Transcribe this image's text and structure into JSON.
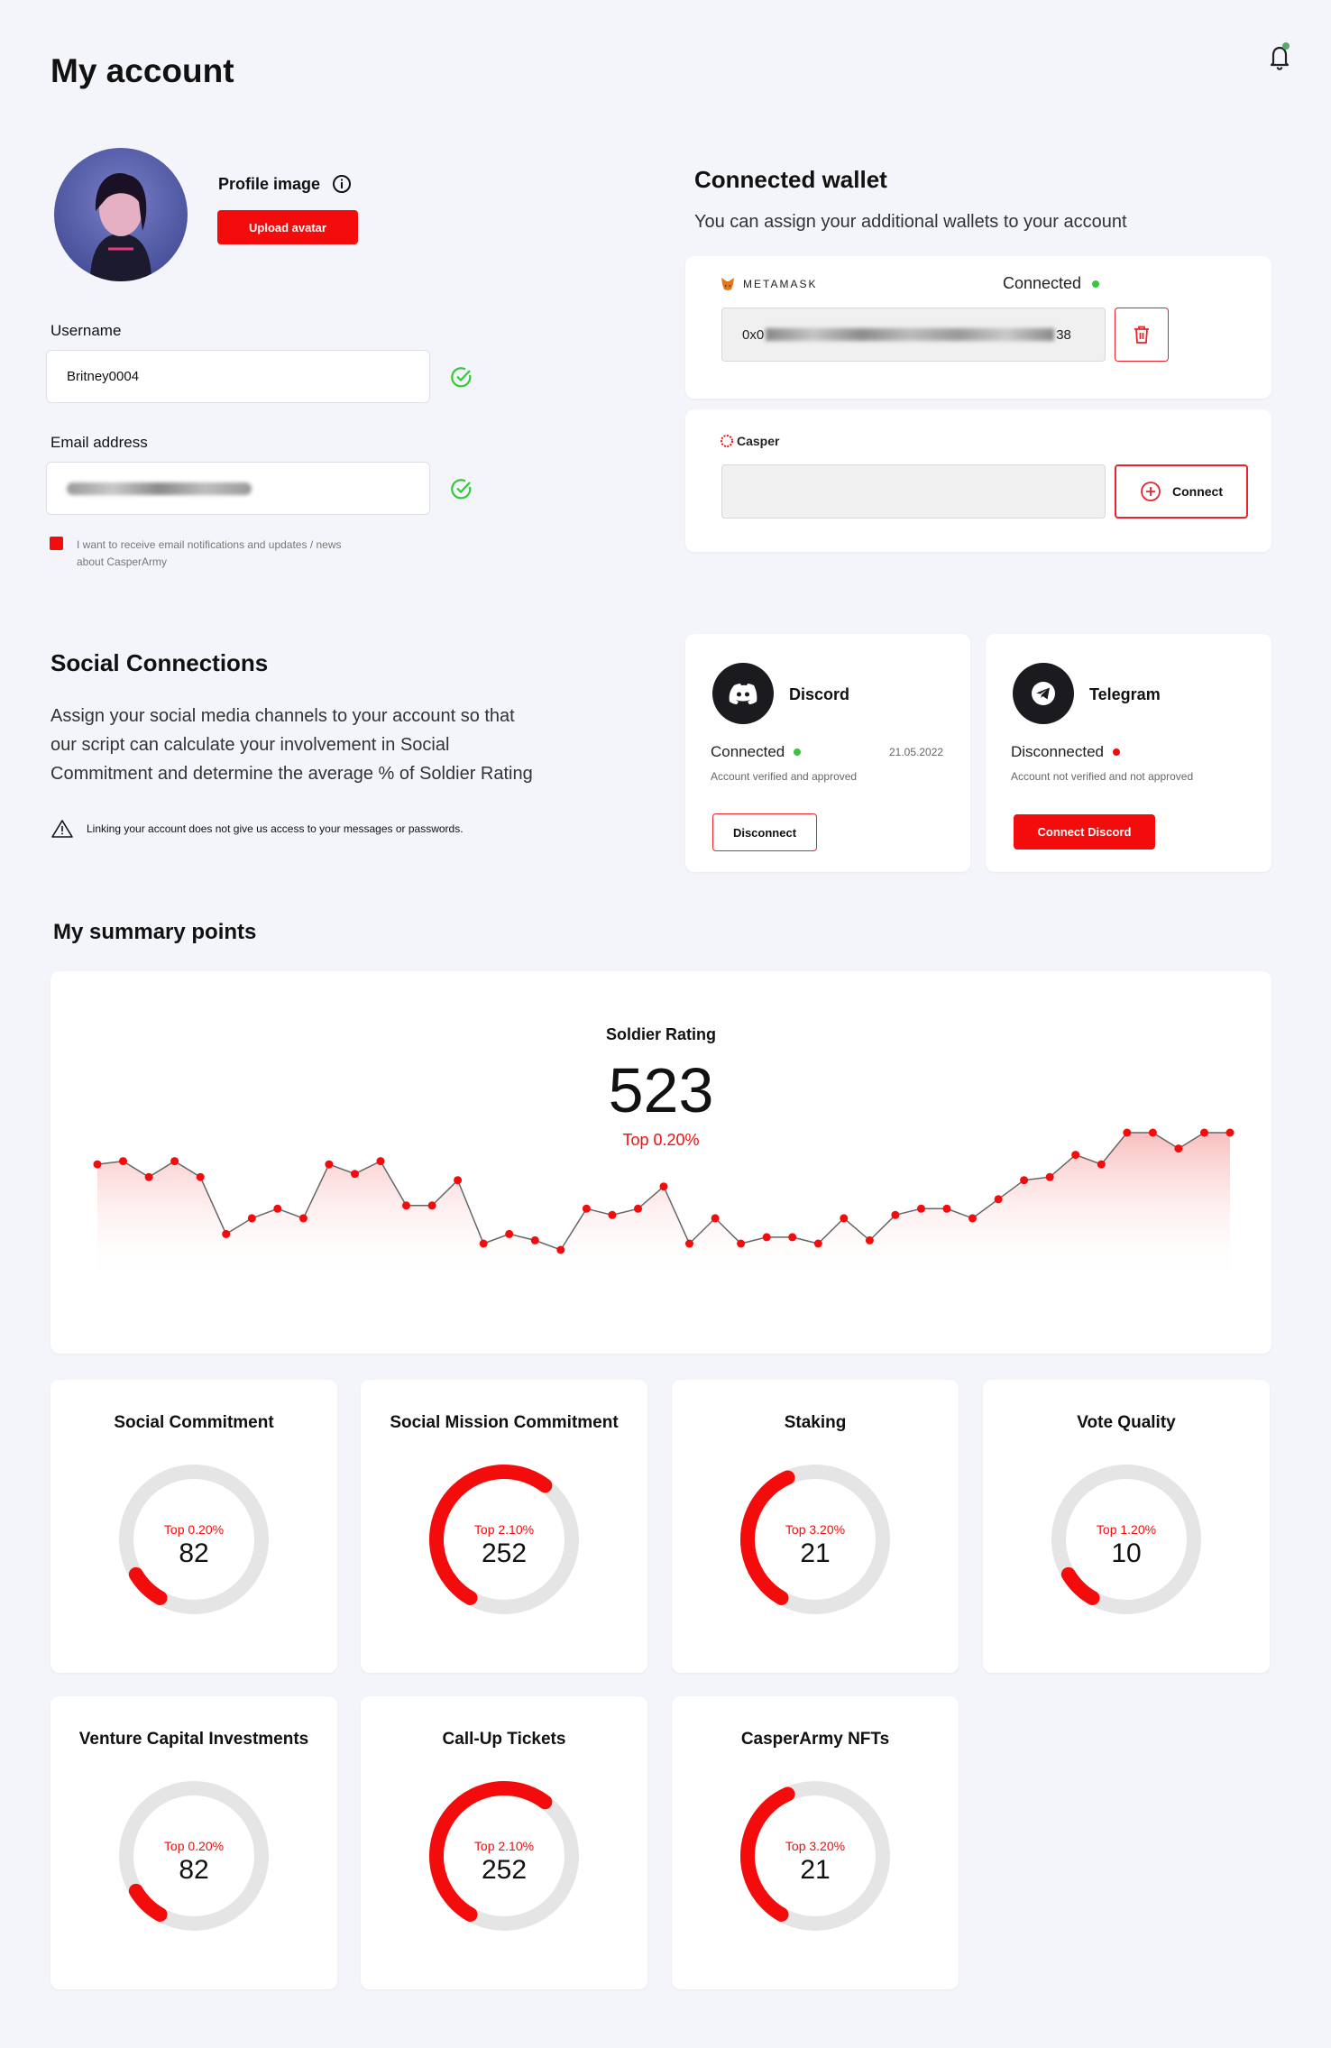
{
  "page": {
    "title": "My account"
  },
  "profile": {
    "image_label": "Profile image",
    "upload_button": "Upload avatar",
    "username_label": "Username",
    "username_value": "Britney0004",
    "email_label": "Email address",
    "email_value": "",
    "notify_text_line1": "I want to receive email notifications and updates / news",
    "notify_text_line2": "about CasperArmy"
  },
  "wallet": {
    "title": "Connected wallet",
    "subtitle": "You can assign your additional wallets to your account",
    "metamask": {
      "brand": "METAMASK",
      "status": "Connected",
      "address_start": "0x0",
      "address_end": "38"
    },
    "casper": {
      "brand": "Casper",
      "connect_button": "Connect"
    }
  },
  "social": {
    "title": "Social Connections",
    "desc_line1": "Assign your social media channels to your account so that",
    "desc_line2": "our script can calculate your involvement in Social",
    "desc_line3": "Commitment and determine the average % of Soldier Rating",
    "warning": "Linking your account does not give us access to your messages or passwords.",
    "discord": {
      "name": "Discord",
      "status": "Connected",
      "date": "21.05.2022",
      "note": "Account verified and approved",
      "button": "Disconnect"
    },
    "telegram": {
      "name": "Telegram",
      "status": "Disconnected",
      "note": "Account not verified and not approved",
      "button": "Connect Discord"
    }
  },
  "summary": {
    "title": "My summary points",
    "rating_label": "Soldier Rating",
    "rating_value": "523",
    "rating_top": "Top 0.20%"
  },
  "colors": {
    "accent": "#f40c0c",
    "green": "#34c83a",
    "dark": "#1b1b1f"
  },
  "chart_data": {
    "type": "area",
    "title": "Soldier Rating",
    "values": [
      62,
      63,
      58,
      63,
      58,
      40,
      45,
      48,
      45,
      62,
      59,
      63,
      49,
      49,
      57,
      37,
      40,
      38,
      35,
      48,
      46,
      48,
      55,
      37,
      45,
      37,
      39,
      39,
      37,
      45,
      38,
      46,
      48,
      48,
      45,
      51,
      57,
      58,
      65,
      62,
      72,
      72,
      67,
      72,
      72
    ]
  },
  "metrics": [
    {
      "title": "Social Commitment",
      "top": "Top 0.20%",
      "value": "82",
      "fraction": 0.08
    },
    {
      "title": "Social Mission Commitment",
      "top": "Top 2.10%",
      "value": "252",
      "fraction": 0.52
    },
    {
      "title": "Staking",
      "top": "Top 3.20%",
      "value": "21",
      "fraction": 0.35
    },
    {
      "title": "Vote Quality",
      "top": "Top 1.20%",
      "value": "10",
      "fraction": 0.08
    },
    {
      "title": "Venture Capital Investments",
      "top": "Top 0.20%",
      "value": "82",
      "fraction": 0.08
    },
    {
      "title": "Call-Up Tickets",
      "top": "Top 2.10%",
      "value": "252",
      "fraction": 0.52
    },
    {
      "title": "CasperArmy NFTs",
      "top": "Top 3.20%",
      "value": "21",
      "fraction": 0.35
    }
  ]
}
